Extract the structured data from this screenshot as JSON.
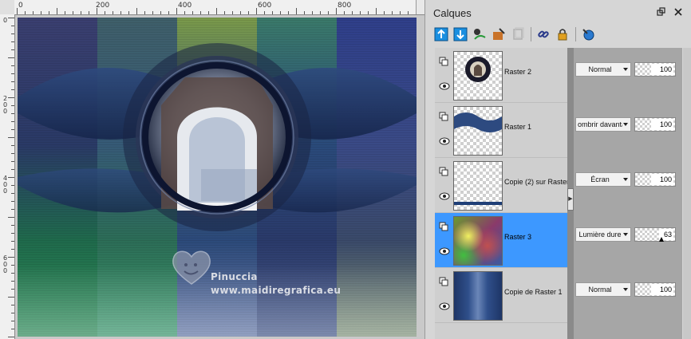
{
  "canvas": {
    "ruler_top_labels": [
      "0",
      "200",
      "400",
      "600",
      "800"
    ],
    "ruler_left_labels": [
      "0",
      "200",
      "400",
      "600"
    ],
    "watermark": {
      "name": "Pinuccia",
      "url": "www.maidiregrafica.eu"
    }
  },
  "palette": {
    "title": "Calques",
    "header_icons": [
      "restore-icon",
      "close-icon"
    ],
    "toolbar": [
      "new-raster-layer-icon",
      "new-vector-layer-icon",
      "new-mask-layer-icon",
      "new-adjustment-layer-icon",
      "delete-layer-icon",
      "link-layers-icon",
      "lock-transparency-icon",
      "layer-properties-icon"
    ],
    "layers": [
      {
        "name": "Raster 2",
        "blend": "Normal",
        "opacity": 100,
        "selected": false,
        "thumb": "round-frame"
      },
      {
        "name": "Raster 1",
        "blend": "Assombrir davantage",
        "blend_visible": "ombrir davanta",
        "opacity": 100,
        "selected": false,
        "thumb": "blue-wave"
      },
      {
        "name": "Copie (2) sur Raster",
        "blend": "Écran",
        "opacity": 100,
        "selected": false,
        "thumb": "transparent-bar"
      },
      {
        "name": "Raster 3",
        "blend": "Lumière dure",
        "opacity": 63,
        "selected": true,
        "thumb": "color-gradient"
      },
      {
        "name": "Copie de Raster 1",
        "blend": "Normal",
        "opacity": 100,
        "selected": false,
        "thumb": "blue-columns"
      }
    ]
  },
  "colors": {
    "selection": "#3d98ff",
    "panel": "#d6d6d6",
    "list_bg": "#cfcfcf",
    "props_bg": "#a6a6a6"
  }
}
